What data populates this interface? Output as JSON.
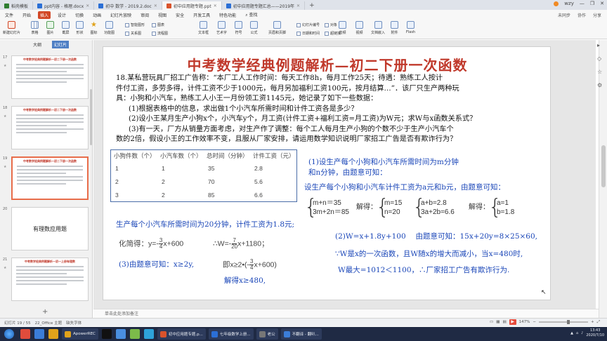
{
  "tabs": [
    {
      "label": "稻壳模板",
      "type": "home"
    },
    {
      "label": "ppt内容 - 格理.docx",
      "type": "w"
    },
    {
      "label": "初中 数学 - 2019.2.doc",
      "type": "w"
    },
    {
      "label": "初中应用题专题.ppt",
      "type": "p",
      "active": true
    },
    {
      "label": "初中应用题专题汇总——2019年",
      "type": "w"
    }
  ],
  "window_controls": {
    "user": "wzy"
  },
  "menu": {
    "items": [
      "文件",
      "开始",
      "插入",
      "设计",
      "切换",
      "动画",
      "幻灯片放映",
      "审阅",
      "视图",
      "安全",
      "开发工具",
      "特色功能"
    ],
    "active": "插入",
    "right": [
      "未同步",
      "协作",
      "分享"
    ],
    "search": "查找"
  },
  "ribbon": {
    "big": [
      "新建幻灯片",
      "表格",
      "图片",
      "截屏",
      "形状",
      "图标",
      "功能图",
      "图表",
      "文本框",
      "艺术字",
      "符号",
      "公式",
      "页眉和页脚",
      "幻灯片编号",
      "对象",
      "音频",
      "视频",
      "文档嵌入",
      "附件",
      "Flash"
    ],
    "small": [
      "智能图形",
      "图表",
      "关系图",
      "流程图",
      "思维导图",
      "日期和时间",
      "超链接"
    ]
  },
  "panel": {
    "tabs": [
      "大纲",
      "幻灯片"
    ],
    "slides": [
      {
        "num": "17",
        "title": "中考数学经典例题解析—初二下册一次函数"
      },
      {
        "num": "18",
        "title": "中考数学经典例题解析—初二下册一次函数"
      },
      {
        "num": "19",
        "title": "中考数学经典例题解析—初二下册一次函数",
        "selected": true
      },
      {
        "num": "20",
        "title": "有理数应用题"
      },
      {
        "num": "21",
        "title": "中考数学经典例题解析—初一上册有理数"
      }
    ]
  },
  "slide": {
    "title": "中考数学经典例题解析—初二下册一次函数",
    "problem": [
      "18.某私营玩具厂招工广告称：“本厂工人工作时间：每天工作8h，每月工作25天；待遇：熟练工人按计",
      "件付工资，多劳多得，计件工资不少于1000元，每月另加福利工资100元，按月结算…”．该厂只生产两种玩",
      "具：小狗和小汽车，熟练工人小王一月份领工资1145元，她记录了如下一些数据：",
      "(1)根据表格中的信息，求出做1个小汽车所需时间和计件工资各是多少？",
      "(2)设小王某月生产小狗x个，小汽车y个，月工资(计件工资+福利工资=月工资)为W元；求W与x函数关系式？",
      "(3)有一天，厂方从销量方面考虑，对生产作了调整：每个工人每月生产小狗的个数不少于生产小汽车个",
      "数的2倍，假设小王的工作效率不变，且服从厂家安排，请运用数学知识说明厂家招工广告是否有欺诈行为？"
    ],
    "table": {
      "headers": [
        "小狗件数（个）",
        "小汽车数（个）",
        "总时间（分钟）",
        "计件工资（元）"
      ],
      "rows": [
        [
          "1",
          "1",
          "35",
          "2.8"
        ],
        [
          "2",
          "2",
          "70",
          "5.6"
        ],
        [
          "3",
          "2",
          "85",
          "6.6"
        ]
      ]
    },
    "sol1a": "(1)设生产每个小狗和小汽车所需时间为m分钟",
    "sol1b": "和n分钟，由题意可知：",
    "sol1c": "设生产每个小狗和小汽车计件工资为a元和b元，由题意可知：",
    "eqs1": [
      "m+n＝35",
      "3m+2n＝85"
    ],
    "solve1_label": "解得：",
    "res1": [
      "m=15",
      "n=20"
    ],
    "eqs2": [
      "a+b=2.8",
      "3a+2b=6.6"
    ],
    "solve2_label": "解得：",
    "res2": [
      "a=1",
      "b=1.8"
    ],
    "conclusion": "生产每个小汽车所需时间为20分钟，计件工资为1.8元;",
    "simplify_label": "化简得：y=-",
    "frac34": [
      "3",
      "4"
    ],
    "simplify_rest": "x+600",
    "w_label": "∴W=-",
    "frac720": [
      "7",
      "20"
    ],
    "w_rest": "x+1180；",
    "sol3a": "(3)由题意可知：x≥2y,",
    "sol3b_pre": "即x≥2•(-",
    "sol3b_post": "x+600)",
    "sol3c": "解得x≥480,",
    "sol2": "(2)W=x+1.8y+100　 由题意可知：15x+20y=8×25×60,",
    "sol2b": "∵W是x的一次函数，且W随x的增大而减小，当x=480时,",
    "sol2c": "W最大=1012＜1100，∴厂家招工广告有欺诈行为."
  },
  "notes": "单击此处添加备注",
  "status": {
    "slide": "幻灯片 19 / 55",
    "theme": "22_Office 主题",
    "spell": "缺失字体",
    "zoom": "147%"
  },
  "taskbar": {
    "apps": [
      "ApowerREC",
      "初中应用题专题.p...",
      "七年级数学上册...",
      "老公",
      "不翻译 - 翻叭..."
    ],
    "time": "13:43",
    "date": "2020/7/10"
  }
}
